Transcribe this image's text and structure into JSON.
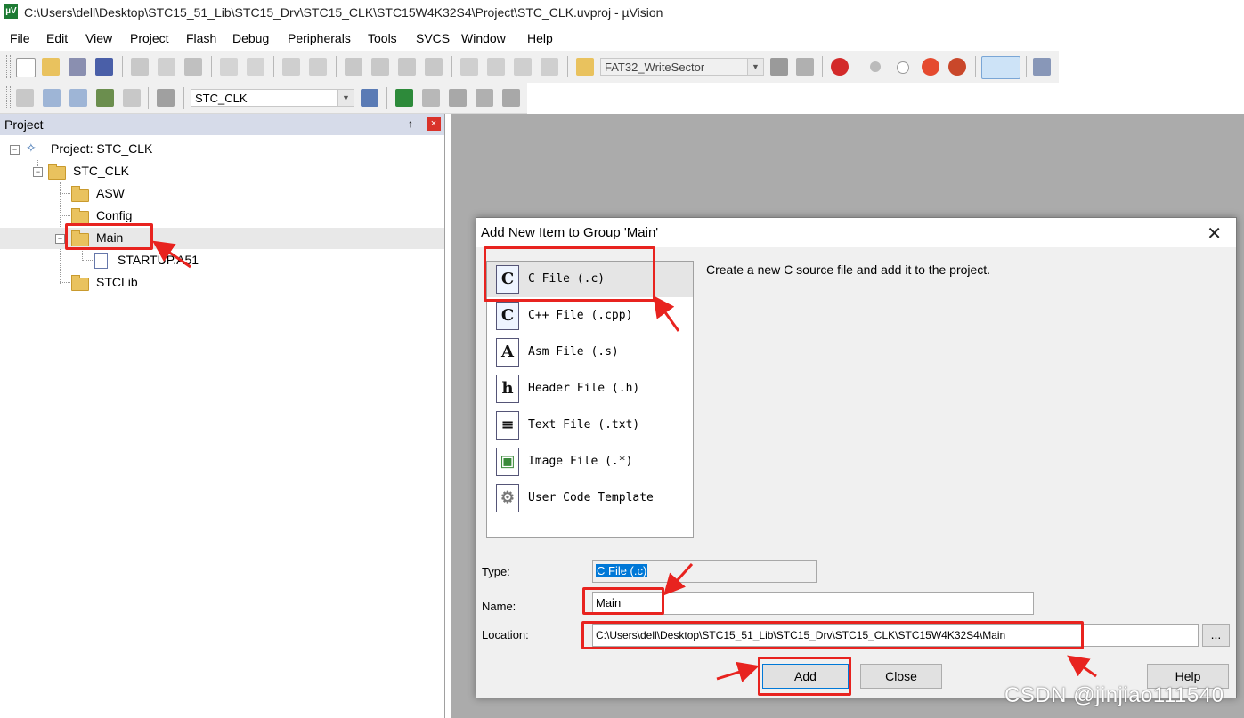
{
  "window": {
    "title": "C:\\Users\\dell\\Desktop\\STC15_51_Lib\\STC15_Drv\\STC15_CLK\\STC15W4K32S4\\Project\\STC_CLK.uvproj - µVision",
    "app_icon": "µV"
  },
  "menu": [
    "File",
    "Edit",
    "View",
    "Project",
    "Flash",
    "Debug",
    "Peripherals",
    "Tools",
    "SVCS",
    "Window",
    "Help"
  ],
  "toolbar1": {
    "function_combo": "FAT32_WriteSector"
  },
  "toolbar2": {
    "target_combo": "STC_CLK"
  },
  "project_panel": {
    "title": "Project",
    "pin": "↑",
    "close": "×",
    "tree": {
      "project": "Project: STC_CLK",
      "target": "STC_CLK",
      "groups": [
        "ASW",
        "Config",
        "Main",
        "STCLib"
      ],
      "file": "STARTUP.A51"
    }
  },
  "dialog": {
    "title": "Add New Item to Group 'Main'",
    "close": "✕",
    "description": "Create a new C source file and add it to the project.",
    "types": [
      {
        "icon": "C",
        "label": "C File (.c)"
      },
      {
        "icon": "C",
        "label": "C++ File (.cpp)"
      },
      {
        "icon": "A",
        "label": "Asm File (.s)"
      },
      {
        "icon": "h",
        "label": "Header File (.h)"
      },
      {
        "icon": "≡",
        "label": "Text File (.txt)"
      },
      {
        "icon": "▣",
        "label": "Image File (.*)"
      },
      {
        "icon": "⚙",
        "label": "User Code Template"
      }
    ],
    "type_label": "Type:",
    "type_value": "C File (.c)",
    "name_label": "Name:",
    "name_value": "Main",
    "location_label": "Location:",
    "location_value": "C:\\Users\\dell\\Desktop\\STC15_51_Lib\\STC15_Drv\\STC15_CLK\\STC15W4K32S4\\Main",
    "browse": "...",
    "add": "Add",
    "close_button": "Close",
    "help": "Help"
  },
  "watermark": "CSDN @jinjiao111540",
  "colors": {
    "annotation_red": "#e8231f",
    "selection_blue": "#0078d7",
    "panel_header": "#d6dbe9"
  }
}
